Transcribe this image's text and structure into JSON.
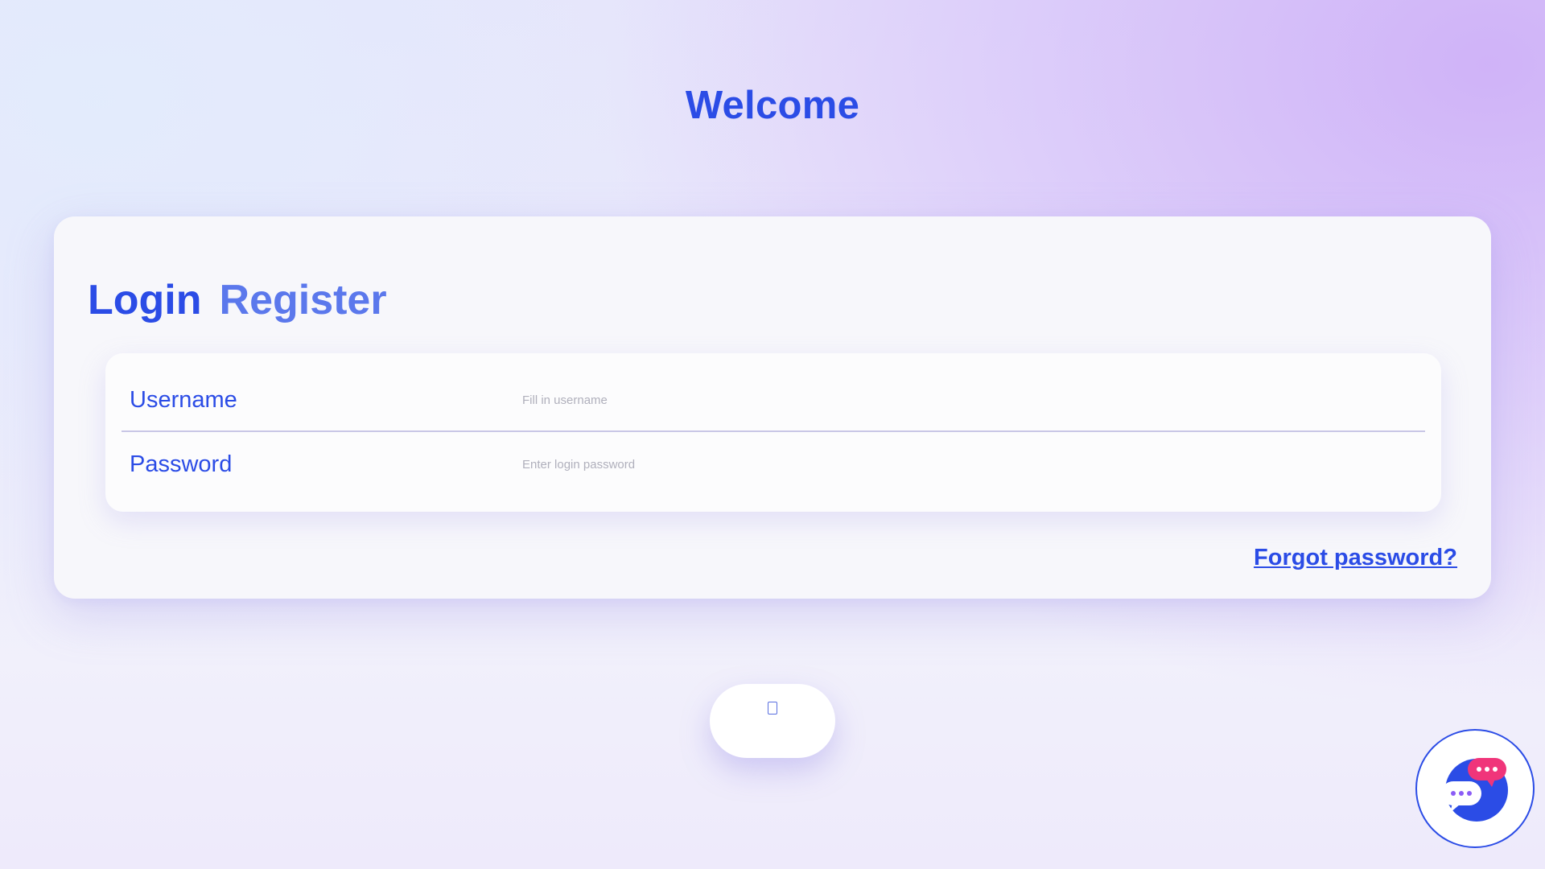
{
  "page": {
    "heading": "Welcome"
  },
  "tabs": {
    "login": "Login",
    "register": "Register"
  },
  "form": {
    "username_label": "Username",
    "username_placeholder": "Fill in username",
    "username_value": "",
    "password_label": "Password",
    "password_placeholder": "Enter login password",
    "password_value": ""
  },
  "links": {
    "forgot_password": "Forgot password?"
  },
  "icons": {
    "submit_button_icon": "missing-glyph-icon",
    "chat_widget_icon": "chat-bubbles-icon"
  },
  "colors": {
    "accent": "#2b4ce6",
    "accent_light": "#5b78ec",
    "chat_badge": "#f0357a"
  }
}
